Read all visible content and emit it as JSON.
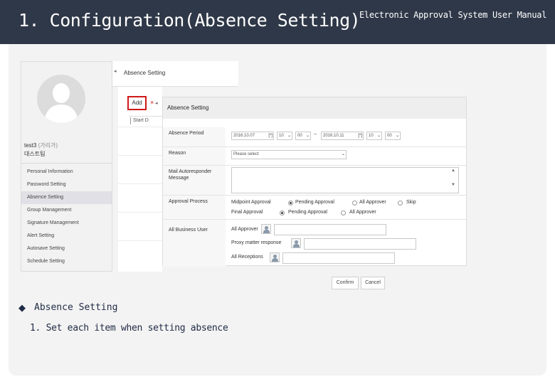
{
  "header": {
    "title": "1. Configuration(Absence Setting)",
    "subtitle": "Electronic Approval System User Manual"
  },
  "screenshot": {
    "profile": {
      "username": "test3",
      "rank": "(가리가)",
      "department": "대스트팀"
    },
    "menu": [
      {
        "label": "Personal Information"
      },
      {
        "label": "Password Setting"
      },
      {
        "label": "Absence Setting"
      },
      {
        "label": "Group Management"
      },
      {
        "label": "Signature Management"
      },
      {
        "label": "Alert Setting"
      },
      {
        "label": "Autosave Setting"
      },
      {
        "label": "Schedule Setting"
      }
    ],
    "page_title": "Absence Setting",
    "add_label": "Add",
    "delete_symbol": "×",
    "collapse_symbol": "◂",
    "list_stub": "Start D",
    "dialog": {
      "title": "Absence Setting",
      "absence_period_label": "Absence Period",
      "start_date": "2016.10.07",
      "start_hour": "10",
      "start_minute": "00",
      "tilde": "~",
      "end_date": "2016.10.11",
      "end_hour": "10",
      "end_minute": "00",
      "calendar_btn": "[*]",
      "reason_label": "Reason",
      "reason_placeholder": "Please select",
      "mail_label": "Mail Autoresponder Message",
      "approval_process_label": "Approval Process",
      "midpoint_label": "Midpoint Approval",
      "midpoint_options": [
        "Pending Approval",
        "All Approver",
        "Skip"
      ],
      "final_label": "Final Approval",
      "final_options": [
        "Pending Approval",
        "All Approver"
      ],
      "business_user_label": "All Business User",
      "all_approver_label": "All Approver",
      "proxy_label": "Proxy matter response",
      "all_receptions_label": "All Receptions"
    },
    "buttons": {
      "confirm": "Confirm",
      "cancel": "Cancel"
    },
    "scroll_up": "▲",
    "scroll_down": "▼"
  },
  "caption": {
    "bullet_symbol": "◆",
    "heading": "Absence Setting",
    "step": "1. Set each item when setting absence"
  },
  "colors": {
    "header_bg": "#2f3848",
    "highlight": "#d01818",
    "text_dark": "#1f2a44"
  }
}
